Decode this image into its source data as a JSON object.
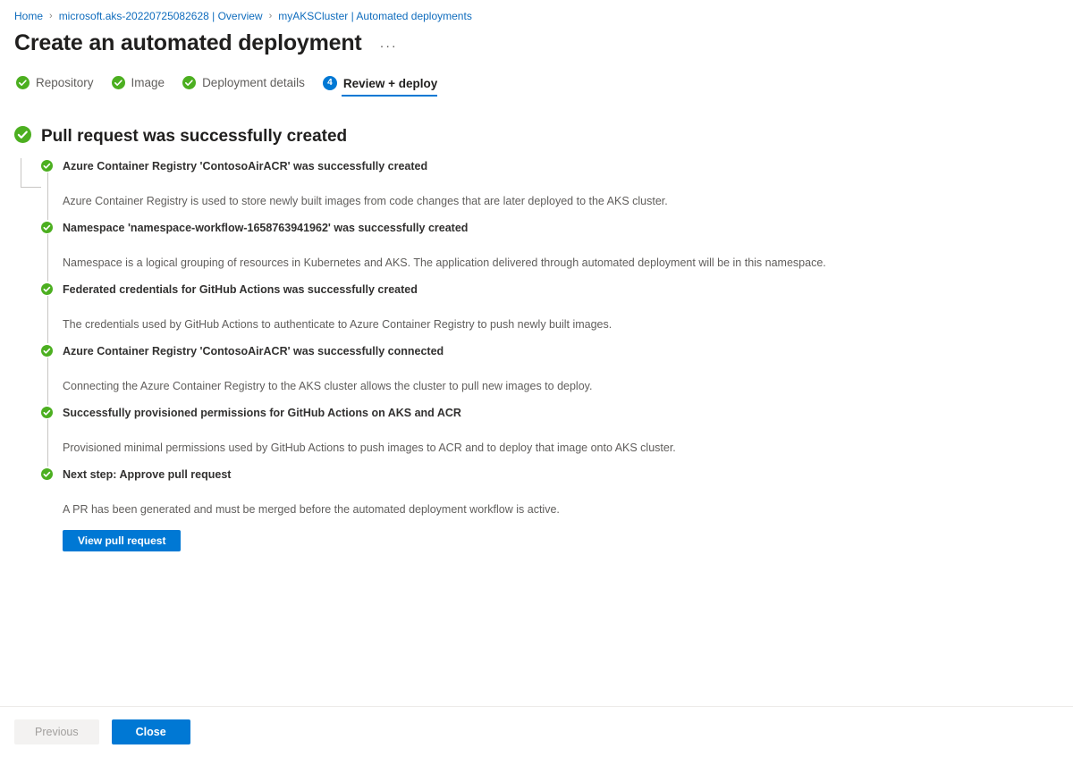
{
  "breadcrumb": {
    "separator": "›",
    "items": [
      {
        "label": "Home"
      },
      {
        "label": "microsoft.aks-20220725082628 | Overview"
      },
      {
        "label": "myAKSCluster | Automated deployments"
      }
    ]
  },
  "header": {
    "title": "Create an automated deployment",
    "more_menu": "···"
  },
  "wizard": {
    "tabs": [
      {
        "label": "Repository",
        "state": "complete",
        "icon": "check-circle-icon"
      },
      {
        "label": "Image",
        "state": "complete",
        "icon": "check-circle-icon"
      },
      {
        "label": "Deployment details",
        "state": "complete",
        "icon": "check-circle-icon"
      },
      {
        "label": "Review + deploy",
        "state": "active",
        "icon": "number-badge",
        "number": "4"
      }
    ]
  },
  "result": {
    "heading": "Pull request was successfully created",
    "heading_icon": "check-circle-icon",
    "items": [
      {
        "title": "Azure Container Registry 'ContosoAirACR' was successfully created",
        "description": "Azure Container Registry is used to store newly built images from code changes that are later deployed to the AKS cluster."
      },
      {
        "title": "Namespace 'namespace-workflow-1658763941962' was successfully created",
        "description": "Namespace is a logical grouping of resources in Kubernetes and AKS. The application delivered through automated deployment will be in this namespace."
      },
      {
        "title": "Federated credentials for GitHub Actions was successfully created",
        "description": "The credentials used by GitHub Actions to authenticate to Azure Container Registry to push newly built images."
      },
      {
        "title": "Azure Container Registry 'ContosoAirACR' was successfully connected",
        "description": "Connecting the Azure Container Registry to the AKS cluster allows the cluster to pull new images to deploy."
      },
      {
        "title": "Successfully provisioned permissions for GitHub Actions on AKS and ACR",
        "description": "Provisioned minimal permissions used by GitHub Actions to push images to ACR and to deploy that image onto AKS cluster."
      },
      {
        "title": "Next step: Approve pull request",
        "description": "A PR has been generated and must be merged before the automated deployment workflow is active.",
        "action_label": "View pull request"
      }
    ]
  },
  "footer": {
    "previous_label": "Previous",
    "close_label": "Close"
  },
  "colors": {
    "accent_blue": "#0078d4",
    "link_blue": "#0f6cbd",
    "success_green": "#107c10",
    "success_green_light": "#4caf20",
    "text_primary": "#201f1e",
    "text_secondary": "#605e5c",
    "divider": "#c8c6c4"
  }
}
